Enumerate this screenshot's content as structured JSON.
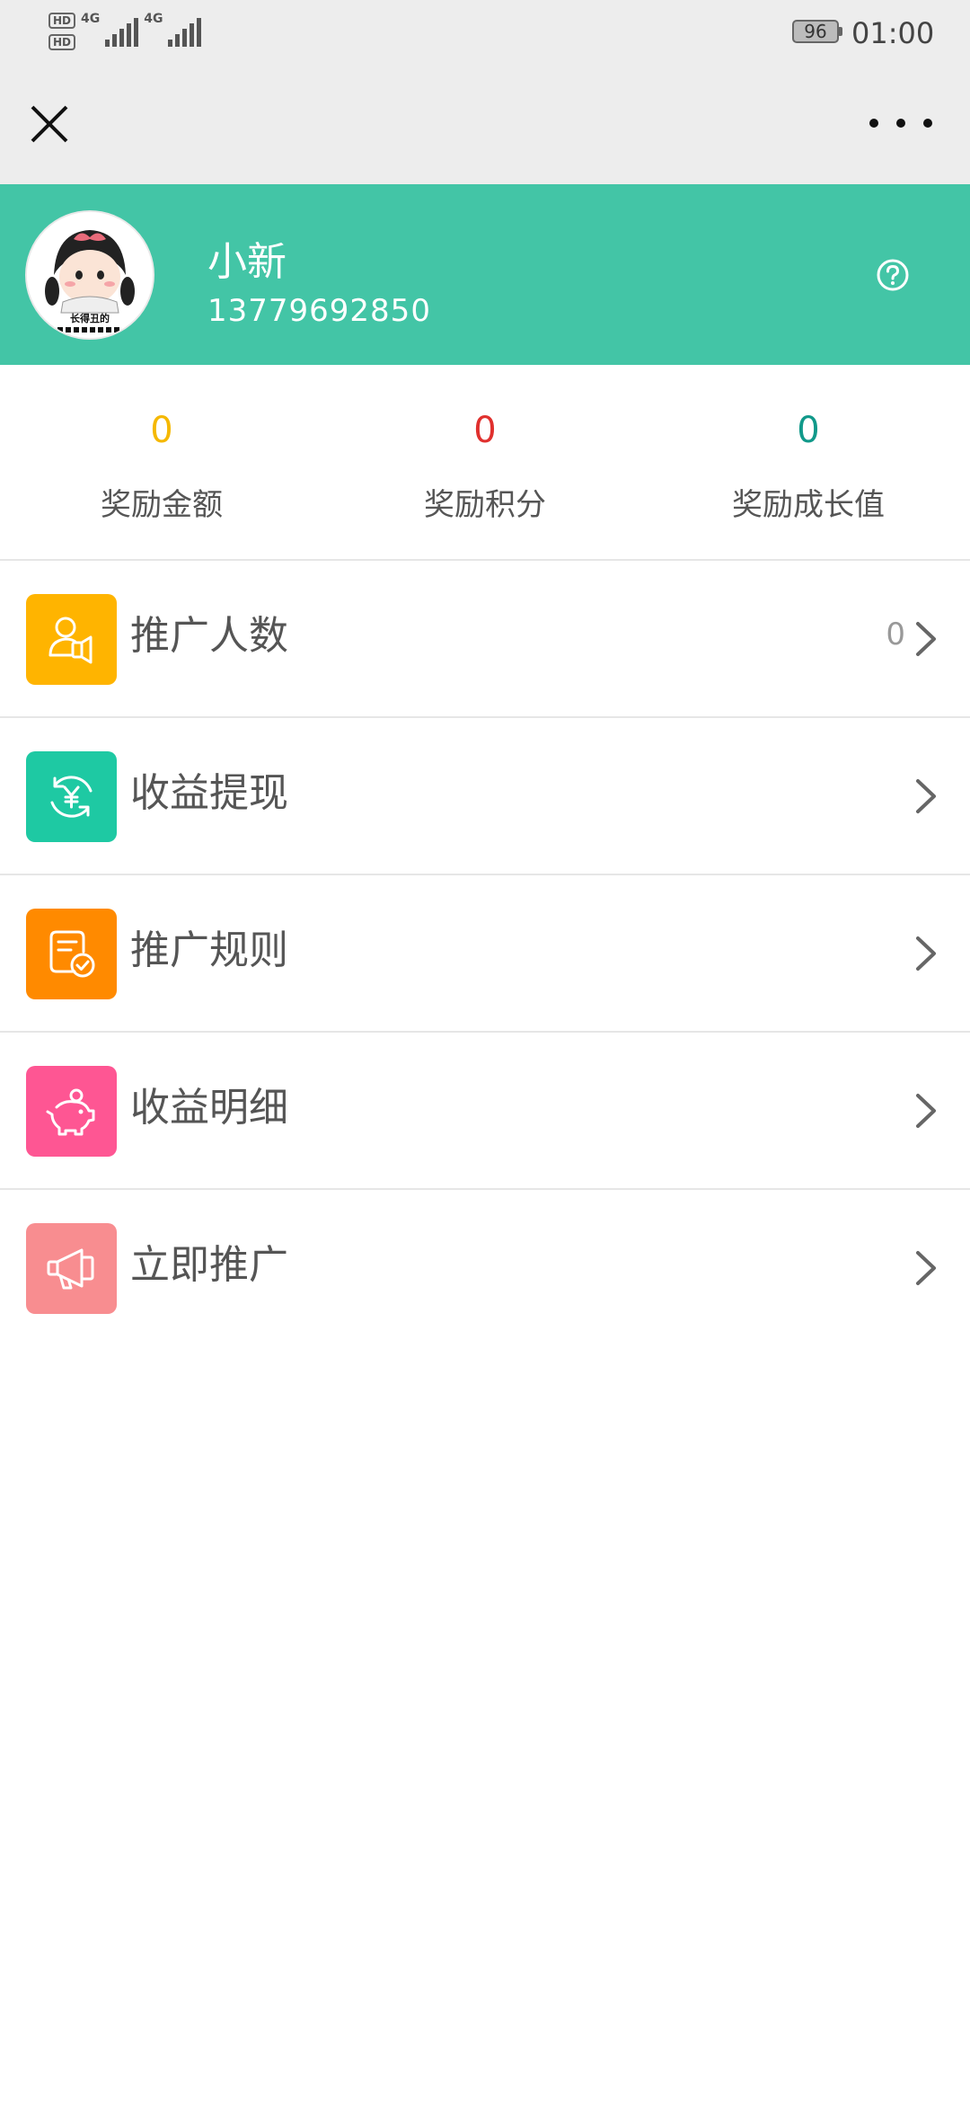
{
  "status_bar": {
    "sim1": "HD",
    "sim1_index": "1",
    "sim2": "HD",
    "sim2_index": "2",
    "network1": "4G",
    "network2": "4G",
    "battery": "96",
    "time": "01:00"
  },
  "profile": {
    "name": "小新",
    "phone": "13779692850",
    "avatar_caption": "长得丑的"
  },
  "stats": [
    {
      "value": "0",
      "label": "奖励金额",
      "color": "#f5b800"
    },
    {
      "value": "0",
      "label": "奖励积分",
      "color": "#e0302e"
    },
    {
      "value": "0",
      "label": "奖励成长值",
      "color": "#11998a"
    }
  ],
  "menu": [
    {
      "label": "推广人数",
      "count": "0",
      "icon": "person-speaker-icon",
      "color": "#ffb400"
    },
    {
      "label": "收益提现",
      "count": "",
      "icon": "yuan-exchange-icon",
      "color": "#1ec9a3"
    },
    {
      "label": "推广规则",
      "count": "",
      "icon": "document-check-icon",
      "color": "#ff8a00"
    },
    {
      "label": "收益明细",
      "count": "",
      "icon": "piggy-bank-icon",
      "color": "#fe5693"
    },
    {
      "label": "立即推广",
      "count": "",
      "icon": "megaphone-icon",
      "color": "#f88d90"
    }
  ],
  "colors": {
    "header_bg": "#43c5a6",
    "bar_bg": "#ededed"
  }
}
